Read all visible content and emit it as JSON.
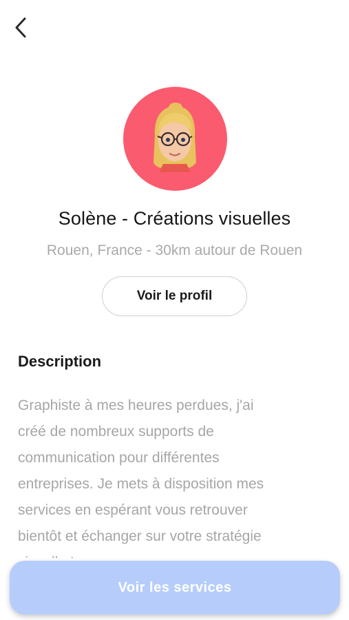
{
  "header": {
    "back_icon": "chevron-left-icon"
  },
  "profile": {
    "avatar_background": "#fb5b6f",
    "avatar_icon": "memoji-avatar",
    "name": "Solène - Créations visuelles",
    "location": "Rouen, France - 30km autour de Rouen",
    "view_profile_label": "Voir le profil"
  },
  "description": {
    "title": "Description",
    "lines": [
      "Graphiste à mes heures perdues, j'ai",
      "créé de nombreux supports de",
      "communication pour différentes",
      "entreprises. Je mets à disposition mes",
      "services en espérant vous retrouver",
      "bientôt et échanger sur votre stratégie",
      "visuelle !"
    ]
  },
  "footer": {
    "cta_label": "Voir les services",
    "cta_color": "#b6cdfb"
  }
}
